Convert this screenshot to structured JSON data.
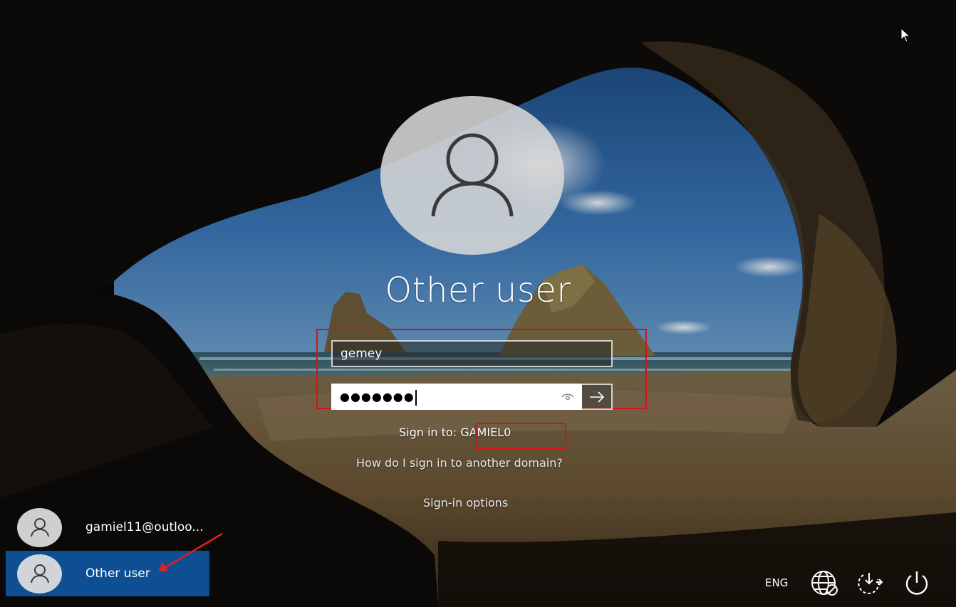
{
  "login": {
    "title": "Other user",
    "username_value": "gemey",
    "password_mask": "●●●●●●●",
    "signin_label": "Sign in to:",
    "domain": "GAMIEL0",
    "link_domain": "How do I sign in to another domain?",
    "link_options": "Sign-in options"
  },
  "users": [
    {
      "name": "gamiel11@outloo...",
      "selected": false
    },
    {
      "name": "Other user",
      "selected": true
    }
  ],
  "tray": {
    "language": "ENG",
    "icons": [
      "network-icon",
      "accessibility-icon",
      "power-icon"
    ]
  },
  "colors": {
    "highlight_box": "#d11414",
    "selected_user_bg": "#0e4f94",
    "annotation_arrow": "#e02020"
  }
}
